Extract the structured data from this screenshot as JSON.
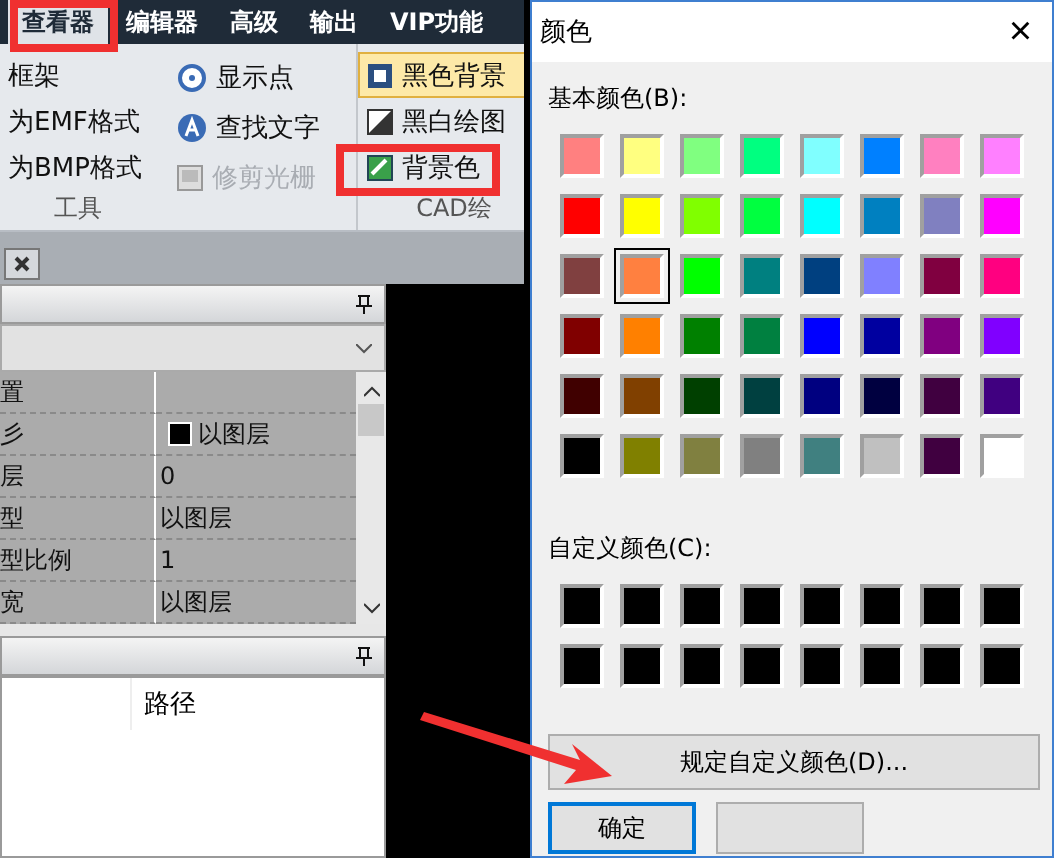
{
  "ribbon": {
    "tabs": [
      {
        "label": "查看器",
        "selected": true
      },
      {
        "label": "编辑器",
        "selected": false
      },
      {
        "label": "高级",
        "selected": false
      },
      {
        "label": "输出",
        "selected": false
      },
      {
        "label": "VIP功能",
        "selected": false
      }
    ],
    "groups": [
      {
        "label": "工具",
        "items": [
          {
            "label": "框架",
            "disabled": false,
            "selected": false
          },
          {
            "label": "为EMF格式",
            "disabled": false,
            "selected": false
          },
          {
            "label": "为BMP格式",
            "disabled": false,
            "selected": false
          }
        ]
      },
      {
        "items": [
          {
            "label": "显示点",
            "disabled": false,
            "selected": false
          },
          {
            "label": "查找文字",
            "disabled": false,
            "selected": false
          },
          {
            "label": "修剪光栅",
            "disabled": true,
            "selected": false
          }
        ]
      },
      {
        "label": "CAD绘",
        "items": [
          {
            "label": "黑色背景",
            "disabled": false,
            "selected": true
          },
          {
            "label": "黑白绘图",
            "disabled": false,
            "selected": false
          },
          {
            "label": "背景色",
            "disabled": false,
            "selected": false
          }
        ]
      }
    ]
  },
  "properties": {
    "category": "置",
    "rows": [
      {
        "name": "彡",
        "value": "以图层",
        "kind": "color"
      },
      {
        "name": "层",
        "value": "0",
        "kind": "text"
      },
      {
        "name": "型",
        "value": "以图层",
        "kind": "text"
      },
      {
        "name": "型比例",
        "value": "1",
        "kind": "text"
      },
      {
        "name": "宽",
        "value": "以图层",
        "kind": "text"
      }
    ]
  },
  "files": {
    "columns": [
      "路径"
    ]
  },
  "dialog": {
    "title": "颜色",
    "close": "×",
    "basic_label": "基本颜色(B):",
    "basic_colors": [
      {
        "color": "#ff8080",
        "selected": false
      },
      {
        "color": "#ffff80",
        "selected": false
      },
      {
        "color": "#80ff80",
        "selected": false
      },
      {
        "color": "#00ff80",
        "selected": false
      },
      {
        "color": "#80ffff",
        "selected": false
      },
      {
        "color": "#0080ff",
        "selected": false
      },
      {
        "color": "#ff80c0",
        "selected": false
      },
      {
        "color": "#ff80ff",
        "selected": false
      },
      {
        "color": "#ff0000",
        "selected": false
      },
      {
        "color": "#ffff00",
        "selected": false
      },
      {
        "color": "#80ff00",
        "selected": false
      },
      {
        "color": "#00ff40",
        "selected": false
      },
      {
        "color": "#00ffff",
        "selected": false
      },
      {
        "color": "#0080c0",
        "selected": false
      },
      {
        "color": "#8080c0",
        "selected": false
      },
      {
        "color": "#ff00ff",
        "selected": false
      },
      {
        "color": "#804040",
        "selected": false
      },
      {
        "color": "#ff8040",
        "selected": true
      },
      {
        "color": "#00ff00",
        "selected": false
      },
      {
        "color": "#008080",
        "selected": false
      },
      {
        "color": "#004080",
        "selected": false
      },
      {
        "color": "#8080ff",
        "selected": false
      },
      {
        "color": "#800040",
        "selected": false
      },
      {
        "color": "#ff0080",
        "selected": false
      },
      {
        "color": "#800000",
        "selected": false
      },
      {
        "color": "#ff8000",
        "selected": false
      },
      {
        "color": "#008000",
        "selected": false
      },
      {
        "color": "#008040",
        "selected": false
      },
      {
        "color": "#0000ff",
        "selected": false
      },
      {
        "color": "#0000a0",
        "selected": false
      },
      {
        "color": "#800080",
        "selected": false
      },
      {
        "color": "#8000ff",
        "selected": false
      },
      {
        "color": "#400000",
        "selected": false
      },
      {
        "color": "#804000",
        "selected": false
      },
      {
        "color": "#004000",
        "selected": false
      },
      {
        "color": "#004040",
        "selected": false
      },
      {
        "color": "#000080",
        "selected": false
      },
      {
        "color": "#000040",
        "selected": false
      },
      {
        "color": "#400040",
        "selected": false
      },
      {
        "color": "#400080",
        "selected": false
      },
      {
        "color": "#000000",
        "selected": false
      },
      {
        "color": "#808000",
        "selected": false
      },
      {
        "color": "#808040",
        "selected": false
      },
      {
        "color": "#808080",
        "selected": false
      },
      {
        "color": "#408080",
        "selected": false
      },
      {
        "color": "#c0c0c0",
        "selected": false
      },
      {
        "color": "#400040",
        "selected": false
      },
      {
        "color": "#ffffff",
        "selected": false
      }
    ],
    "custom_label": "自定义颜色(C):",
    "custom_colors": [
      {
        "color": "#000000"
      },
      {
        "color": "#000000"
      },
      {
        "color": "#000000"
      },
      {
        "color": "#000000"
      },
      {
        "color": "#000000"
      },
      {
        "color": "#000000"
      },
      {
        "color": "#000000"
      },
      {
        "color": "#000000"
      },
      {
        "color": "#000000"
      },
      {
        "color": "#000000"
      },
      {
        "color": "#000000"
      },
      {
        "color": "#000000"
      },
      {
        "color": "#000000"
      },
      {
        "color": "#000000"
      },
      {
        "color": "#000000"
      },
      {
        "color": "#000000"
      }
    ],
    "define_button": "规定自定义颜色(D)...",
    "buttons": [
      {
        "label": "确定",
        "focused": true
      },
      {
        "focused": false
      }
    ]
  }
}
